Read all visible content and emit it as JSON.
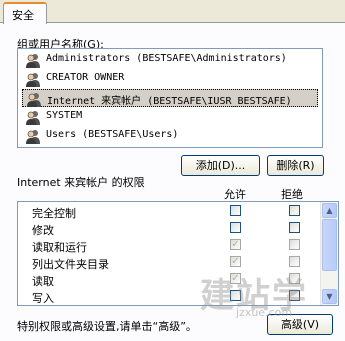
{
  "tab": {
    "label": "安全"
  },
  "users_section": {
    "label": "组或用户名称(G):"
  },
  "users": [
    {
      "name": "Administrators (BESTSAFE\\Administrators)",
      "selected": false
    },
    {
      "name": "CREATOR OWNER",
      "selected": false
    },
    {
      "name": "Internet 来宾帐户 (BESTSAFE\\IUSR_BESTSAFE)",
      "selected": true
    },
    {
      "name": "SYSTEM",
      "selected": false
    },
    {
      "name": "Users (BESTSAFE\\Users)",
      "selected": false
    }
  ],
  "buttons": {
    "add": "添加(D)...",
    "remove": "删除(R)",
    "advanced": "高级(V)"
  },
  "permissions": {
    "label": "Internet 来宾帐户 的权限",
    "allow_header": "允许",
    "deny_header": "拒绝",
    "rows": [
      {
        "name": "完全控制",
        "allow": false,
        "deny": false,
        "inherited": false
      },
      {
        "name": "修改",
        "allow": false,
        "deny": false,
        "inherited": false
      },
      {
        "name": "读取和运行",
        "allow": true,
        "deny": false,
        "inherited": true
      },
      {
        "name": "列出文件夹目录",
        "allow": true,
        "deny": false,
        "inherited": true
      },
      {
        "name": "读取",
        "allow": true,
        "deny": false,
        "inherited": true
      },
      {
        "name": "写入",
        "allow": false,
        "deny": false,
        "inherited": false
      }
    ]
  },
  "footer": {
    "note": "特别权限或高级设置,请单击“高级”。"
  },
  "watermark": {
    "main": "建站学",
    "sub": "jzxue.com"
  },
  "colors": {
    "selection": "#d4d0c8",
    "check": "#21a121",
    "tab_accent": "#e68b2c"
  }
}
